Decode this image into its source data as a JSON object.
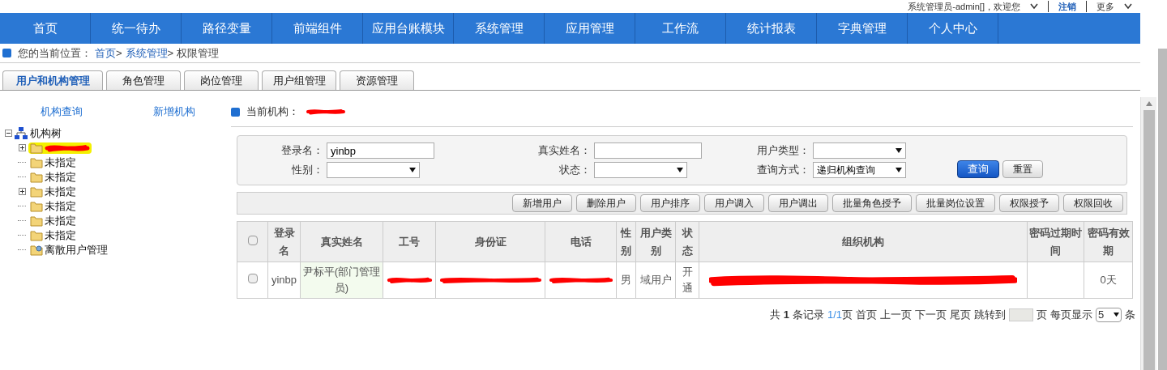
{
  "top_bar": {
    "welcome": "系统管理员-admin[]，欢迎您",
    "logout": "注销",
    "more": "更多"
  },
  "nav": [
    {
      "label": "首页",
      "selected": false
    },
    {
      "label": "统一待办",
      "selected": false
    },
    {
      "label": "路径变量",
      "selected": false
    },
    {
      "label": "前端组件",
      "selected": false
    },
    {
      "label": "应用台账模块",
      "selected": false
    },
    {
      "label": "系统管理",
      "selected": false
    },
    {
      "label": "应用管理",
      "selected": false
    },
    {
      "label": "工作流",
      "selected": false
    },
    {
      "label": "统计报表",
      "selected": false
    },
    {
      "label": "字典管理",
      "selected": false
    },
    {
      "label": "个人中心",
      "selected": false
    }
  ],
  "breadcrumb": {
    "label": "您的当前位置：",
    "links": [
      "首页",
      "系统管理"
    ],
    "separator": ">",
    "current": "权限管理"
  },
  "tabs": [
    {
      "label": "用户和机构管理",
      "selected": true
    },
    {
      "label": "角色管理",
      "selected": false
    },
    {
      "label": "岗位管理",
      "selected": false
    },
    {
      "label": "用户组管理",
      "selected": false
    },
    {
      "label": "资源管理",
      "selected": false
    }
  ],
  "sidebar": {
    "links": [
      "机构查询",
      "新增机构"
    ],
    "tree": {
      "label": "机构树",
      "expanded": true,
      "children": [
        {
          "kind": "redacted",
          "expandable": true,
          "highlighted": true
        },
        {
          "kind": "folder",
          "label": "未指定",
          "expandable": false,
          "highlighted": false
        },
        {
          "kind": "folder",
          "label": "未指定",
          "expandable": false,
          "highlighted": false
        },
        {
          "kind": "folder",
          "label": "未指定",
          "expandable": true,
          "highlighted": false
        },
        {
          "kind": "folder",
          "label": "未指定",
          "expandable": false,
          "highlighted": false
        },
        {
          "kind": "folder",
          "label": "未指定",
          "expandable": false,
          "highlighted": false
        },
        {
          "kind": "folder",
          "label": "未指定",
          "expandable": false,
          "highlighted": false
        },
        {
          "kind": "user-folder",
          "label": "离散用户管理",
          "expandable": false,
          "highlighted": false
        }
      ]
    }
  },
  "current_org": {
    "label": "当前机构："
  },
  "search": {
    "fields": [
      {
        "label": "登录名：",
        "kind": "input",
        "value": "yinbp"
      },
      {
        "label": "真实姓名：",
        "kind": "input"
      },
      {
        "label": "用户类型：",
        "kind": "select"
      },
      {
        "label": "性别：",
        "kind": "select"
      },
      {
        "label": "状态：",
        "kind": "select"
      },
      {
        "label": "查询方式：",
        "kind": "select",
        "value": "递归机构查询"
      }
    ],
    "buttons": [
      {
        "label": "查询",
        "primary": true
      },
      {
        "label": "重置",
        "primary": false
      }
    ]
  },
  "toolbar": [
    "新增用户",
    "删除用户",
    "用户排序",
    "用户调入",
    "用户调出",
    "批量角色授予",
    "批量岗位设置",
    "权限授予",
    "权限回收"
  ],
  "table": {
    "select_all_checked": false,
    "columns": [
      "登录名",
      "真实姓名",
      "工号",
      "身份证",
      "电话",
      "性别",
      "用户类别",
      "状态",
      "组织机构",
      "密码过期时间",
      "密码有效期"
    ],
    "rows": [
      {
        "checked": false,
        "cells": [
          {
            "text": "yinbp",
            "redacted": false
          },
          {
            "text": "尹标平(部门管理员)",
            "redacted": false
          },
          {
            "redacted": true
          },
          {
            "redacted": true
          },
          {
            "redacted": true
          },
          {
            "text": "男",
            "redacted": false
          },
          {
            "text": "域用户",
            "redacted": false
          },
          {
            "text": "开通",
            "redacted": false
          },
          {
            "redacted": true
          },
          {
            "redacted": false
          },
          {
            "text": "0天",
            "redacted": false
          }
        ]
      }
    ]
  },
  "pagination": {
    "prefix": "共",
    "count": "1",
    "records": "条记录",
    "page": "1/1",
    "page_suffix": "页",
    "links": [
      "首页",
      "上一页",
      "下一页",
      "尾页"
    ],
    "jump": "跳转到",
    "jump_suffix": "页",
    "per_page": "每页显示",
    "per_page_value": "5",
    "per_page_suffix": "条"
  }
}
